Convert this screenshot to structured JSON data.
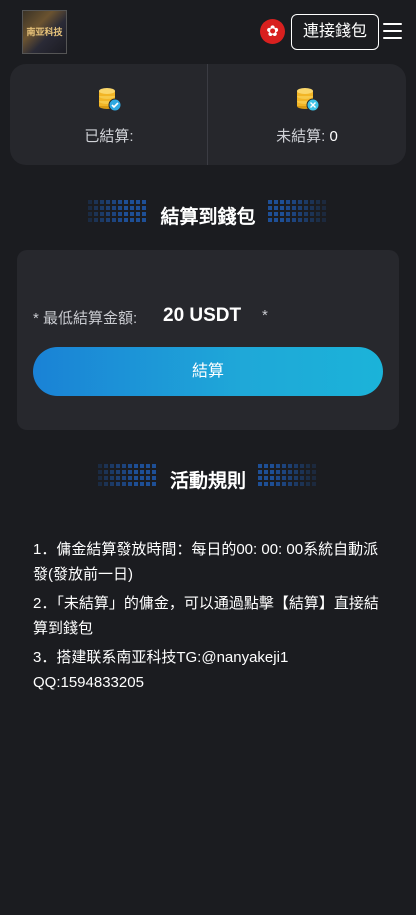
{
  "header": {
    "logo_text": "南亚科技",
    "flag_icon": "hong-kong-flag",
    "connect_label": "連接錢包",
    "menu_icon": "hamburger-menu-icon"
  },
  "stats": {
    "settled_label": "已結算:",
    "unsettled_label": "未結算:",
    "unsettled_value": "0",
    "coin_color": "#f2b526",
    "check_color": "#2fa8e0"
  },
  "settle_section": {
    "title": "結算到錢包",
    "min_label": "* 最低結算金額:",
    "min_value": "20 USDT",
    "min_star": "*",
    "button_label": "結算",
    "accent": "#1a82d6"
  },
  "rules_section": {
    "title": "活動規則",
    "items": [
      "1．傭金結算發放時間：每日的00: 00: 00系統自動派發(發放前一日)",
      "2．「未結算」的傭金，可以通過點擊【結算】直接結算到錢包",
      "3．搭建联系南亚科技TG:@nanyakeji1 QQ:1594833205"
    ]
  }
}
